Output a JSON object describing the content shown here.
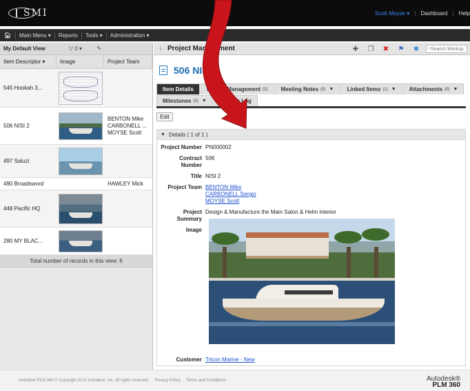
{
  "header": {
    "logo_text": "SMI",
    "user": "Scott Moyse ▾",
    "links": [
      "Dashboard",
      "Help"
    ]
  },
  "menu": {
    "items": [
      "Main Menu ▾",
      "Reports",
      "Tools ▾",
      "Administration ▾"
    ]
  },
  "left": {
    "view_name": "My Default View",
    "filter_label": "▽ 0 ▾",
    "columns": [
      "Item Descriptor ▾",
      "Image",
      "Project Team"
    ],
    "rows": [
      {
        "descriptor": "545 Hookah 3...",
        "team": ""
      },
      {
        "descriptor": "506 NISI 2",
        "team": "BENTON Mike CARBONELL ... MOYSE Scott"
      },
      {
        "descriptor": "497 Saluzi",
        "team": ""
      },
      {
        "descriptor": "490 Broadsword",
        "team": "HAWLEY Mick"
      },
      {
        "descriptor": "448 Pacific HQ",
        "team": ""
      },
      {
        "descriptor": "280 MY BLAC...",
        "team": ""
      }
    ],
    "total_text": "Total number of records in this view: 6"
  },
  "right": {
    "workspace_title": "Project Management",
    "search_placeholder": "Search Workspace",
    "item_title": "506 NISI 2",
    "tabs_row1": [
      {
        "label": "Item Details",
        "count": "",
        "dd": ""
      },
      {
        "label": "Project Management",
        "count": "(2)",
        "dd": ""
      },
      {
        "label": "Meeting Notes",
        "count": "(0)",
        "dd": "▼"
      },
      {
        "label": "Linked Items",
        "count": "(1)",
        "dd": "▼"
      },
      {
        "label": "Attachments",
        "count": "(0)",
        "dd": "▼"
      }
    ],
    "tabs_row2": [
      {
        "label": "Milestones",
        "count": "(0)",
        "dd": "▼"
      },
      {
        "label": "Change Log",
        "count": "",
        "dd": ""
      }
    ],
    "edit_label": "Edit",
    "details_header": "Details ( 1 of 1 )",
    "fields": {
      "project_number_label": "Project Number",
      "project_number": "PN000002",
      "contract_number_label": "Contract Number",
      "contract_number": "506",
      "title_label": "Title",
      "title": "NISI 2",
      "project_team_label": "Project Team",
      "project_team": [
        "BENTON Mike",
        "CARBONELL Sergio",
        "MOYSE Scott"
      ],
      "summary_label": "Project Summary",
      "summary": "Design & Manufacture the Main Salon & Helm interior",
      "image_label": "Image",
      "customer_label": "Customer",
      "customer": "Tricon Marine - New"
    }
  },
  "footer": {
    "copyright": "Autodesk PLM 360 © Copyright 2012 Autodesk, Inc. All rights reserved.",
    "privacy": "Privacy Policy",
    "terms": "Terms and Conditions",
    "brand_line1": "Autodesk®",
    "brand_line2": "PLM 360"
  },
  "colors": {
    "accent_blue": "#1c6fb4",
    "link_blue": "#1c4fcf",
    "header_black": "#0c0c0c",
    "arrow_red": "#c8151b"
  }
}
